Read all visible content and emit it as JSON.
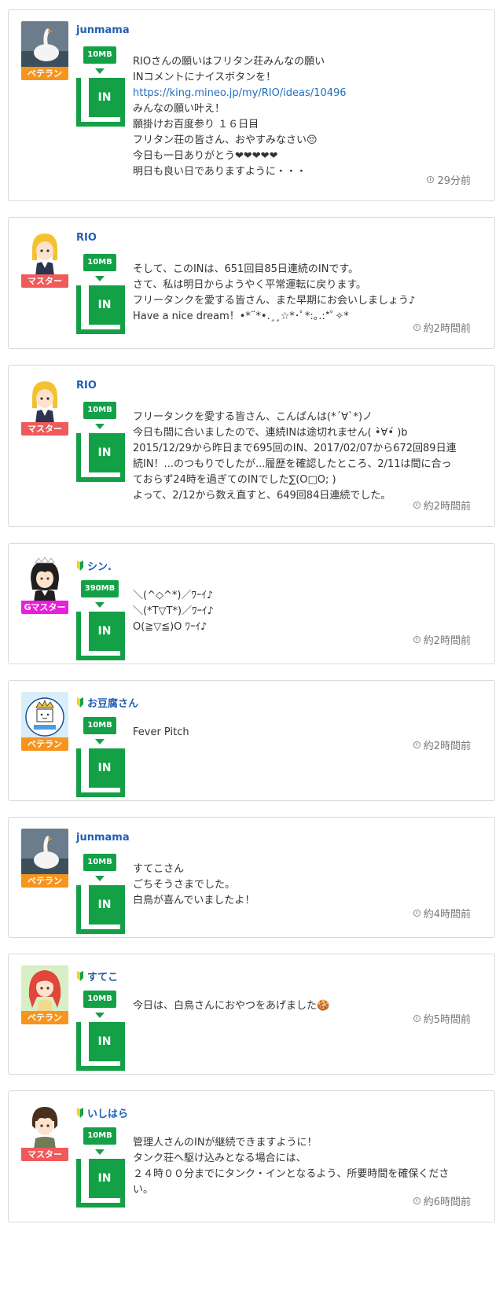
{
  "colors": {
    "accent": "#14a047",
    "link": "#1f5fb4",
    "badge_veteran": "#f7941d",
    "badge_master": "#ef5a5a",
    "badge_gmaster": "#ea1fd9"
  },
  "posts": [
    {
      "user": "junmama",
      "rank": "ベテラン",
      "rank_type": "veteran",
      "avatar": "swan-avatar",
      "beginner": false,
      "amount": "10MB",
      "in_label": "IN",
      "lines": [
        "RIOさんの願いはフリタン荘みんなの願い",
        "INコメントにナイスボタンを！",
        "https://king.mineo.jp/my/RIO/ideas/10496",
        "みんなの願い叶え！",
        "願掛けお百度参り １６日目",
        "フリタン荘の皆さん、おやすみなさい😔",
        "今日も一日ありがとう❤❤❤❤❤",
        "明日も良い日でありますように・・・"
      ],
      "time": "29分前"
    },
    {
      "user": "RIO",
      "rank": "マスター",
      "rank_type": "master",
      "avatar": "blonde-girl-avatar",
      "beginner": false,
      "amount": "10MB",
      "in_label": "IN",
      "lines": [
        "そして、このINは、651回目85日連続のINです。",
        "さて、私は明日からようやく平常運転に戻ります。",
        "フリータンクを愛する皆さん、また早期にお会いしましょう♪",
        "Have a nice dream！•*¨*•.¸¸☆*･ﾟ*:｡.:*ﾟ✧*"
      ],
      "time": "約2時間前"
    },
    {
      "user": "RIO",
      "rank": "マスター",
      "rank_type": "master",
      "avatar": "blonde-girl-avatar",
      "beginner": false,
      "amount": "10MB",
      "in_label": "IN",
      "lines": [
        "フリータンクを愛する皆さん、こんばんは(*´∀`*)ノ",
        "今日も間に合いましたので、連続INは途切れません( •̀∀•́ )b",
        "2015/12/29から昨日まで695回のIN、2017/02/07から672回89日連",
        "続IN！...のつもりでしたが...履歴を確認したところ、2/11は間に合っ",
        "ておらず24時を過ぎてのINでした∑(O□O; )",
        "よって、2/12から数え直すと、649回84日連続でした。"
      ],
      "time": "約2時間前"
    },
    {
      "user": "シン.",
      "rank": "Gマスター",
      "rank_type": "gmaster",
      "avatar": "maid-avatar",
      "beginner": true,
      "amount": "390MB",
      "in_label": "IN",
      "lines": [
        "＼(^◇^*)／ﾜｰｲ♪",
        "＼(*T▽T*)／ﾜｰｲ♪",
        "O(≧▽≦)O ﾜｰｲ♪"
      ],
      "time": "約2時間前"
    },
    {
      "user": "お豆腐さん",
      "rank": "ベテラン",
      "rank_type": "veteran",
      "avatar": "tofu-avatar",
      "beginner": true,
      "amount": "10MB",
      "in_label": "IN",
      "lines": [
        "Fever Pitch"
      ],
      "time": "約2時間前"
    },
    {
      "user": "junmama",
      "rank": "ベテラン",
      "rank_type": "veteran",
      "avatar": "swan-avatar",
      "beginner": false,
      "amount": "10MB",
      "in_label": "IN",
      "lines": [
        "すてこさん",
        "ごちそうさまでした。",
        "白鳥が喜んでいましたよ！"
      ],
      "time": "約4時間前"
    },
    {
      "user": "すてこ",
      "rank": "ベテラン",
      "rank_type": "veteran",
      "avatar": "redhair-avatar",
      "beginner": true,
      "amount": "10MB",
      "in_label": "IN",
      "lines": [
        "今日は、白鳥さんにおやつをあげました🍪"
      ],
      "time": "約5時間前"
    },
    {
      "user": "いしはら",
      "rank": "マスター",
      "rank_type": "master",
      "avatar": "brownhair-avatar",
      "beginner": true,
      "amount": "10MB",
      "in_label": "IN",
      "lines": [
        "管理人さんのINが継続できますように！",
        "タンク荘へ駆け込みとなる場合には、",
        "２４時００分までにタンク・インとなるよう、所要時間を確保くださ",
        "い。"
      ],
      "time": "約6時間前"
    }
  ]
}
